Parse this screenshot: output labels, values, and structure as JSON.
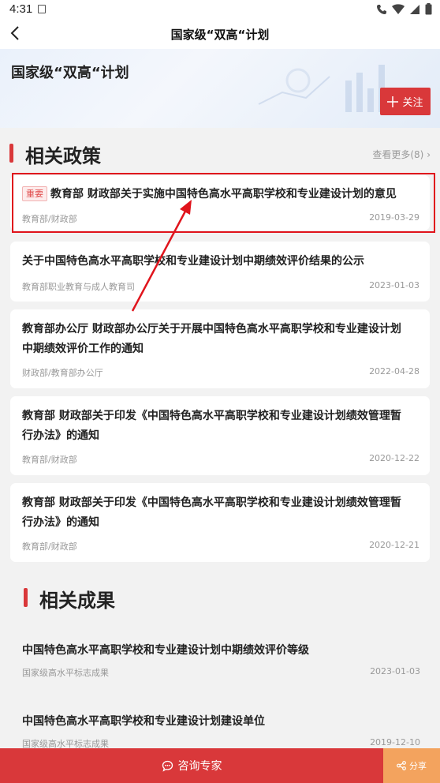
{
  "status_bar": {
    "time": "4:31"
  },
  "header": {
    "title": "国家级“双高“计划"
  },
  "banner": {
    "title": "国家级“双高“计划",
    "follow_label": "关注"
  },
  "policies": {
    "title": "相关政策",
    "more_label": "查看更多(8)",
    "items": [
      {
        "tag": "重要",
        "title": "教育部 财政部关于实施中国特色高水平高职学校和专业建设计划的意见",
        "source": "教育部/财政部",
        "date": "2019-03-29"
      },
      {
        "title": "关于中国特色高水平高职学校和专业建设计划中期绩效评价结果的公示",
        "source": "教育部职业教育与成人教育司",
        "date": "2023-01-03"
      },
      {
        "title_line1": "教育部办公厅 财政部办公厅关于开展中国特色高水平高职学校和专业建设计划",
        "title_line2": "中期绩效评价工作的通知",
        "source": "财政部/教育部办公厅",
        "date": "2022-04-28"
      },
      {
        "title_line1": "教育部 财政部关于印发《中国特色高水平高职学校和专业建设计划绩效管理暂",
        "title_line2": "行办法》的通知",
        "source": "教育部/财政部",
        "date": "2020-12-22"
      },
      {
        "title_line1": "教育部 财政部关于印发《中国特色高水平高职学校和专业建设计划绩效管理暂",
        "title_line2": "行办法》的通知",
        "source": "教育部/财政部",
        "date": "2020-12-21"
      }
    ]
  },
  "results": {
    "title": "相关成果",
    "items": [
      {
        "title": "中国特色高水平高职学校和专业建设计划中期绩效评价等级",
        "source": "国家级高水平标志成果",
        "date": "2023-01-03"
      },
      {
        "title": "中国特色高水平高职学校和专业建设计划建设单位",
        "source": "国家级高水平标志成果",
        "date": "2019-12-10"
      }
    ]
  },
  "bottom_bar": {
    "consult_label": "咨询专家",
    "share_label": "分享"
  },
  "colors": {
    "accent": "#d9383a",
    "share": "#f3a35e",
    "highlight": "#e0141c"
  }
}
